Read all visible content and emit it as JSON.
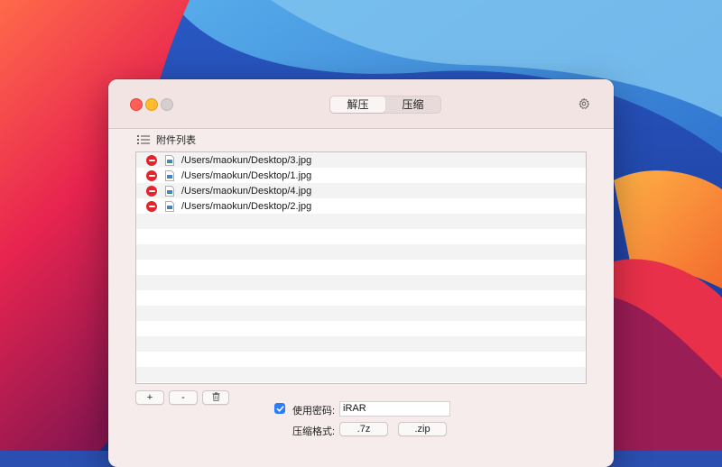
{
  "tabs": [
    {
      "label": "解压"
    },
    {
      "label": "压缩"
    }
  ],
  "attachments": {
    "title": "附件列表",
    "files": [
      "/Users/maokun/Desktop/3.jpg",
      "/Users/maokun/Desktop/1.jpg",
      "/Users/maokun/Desktop/4.jpg",
      "/Users/maokun/Desktop/2.jpg"
    ]
  },
  "toolbar": {
    "add_label": "+",
    "remove_label": "-"
  },
  "password": {
    "label": "使用密码:",
    "value": "iRAR",
    "checked": true
  },
  "format": {
    "label": "压缩格式:",
    "options": [
      ".7z",
      ".zip"
    ]
  },
  "colors": {
    "accent": "#2d7cf6",
    "remove": "#e0262c",
    "window_bg": "#f6ecec"
  },
  "icons": {
    "settings": "gear-icon",
    "list": "list-icon",
    "trash": "trash-icon",
    "file": "image-file-icon",
    "remove": "remove-circle-icon"
  }
}
